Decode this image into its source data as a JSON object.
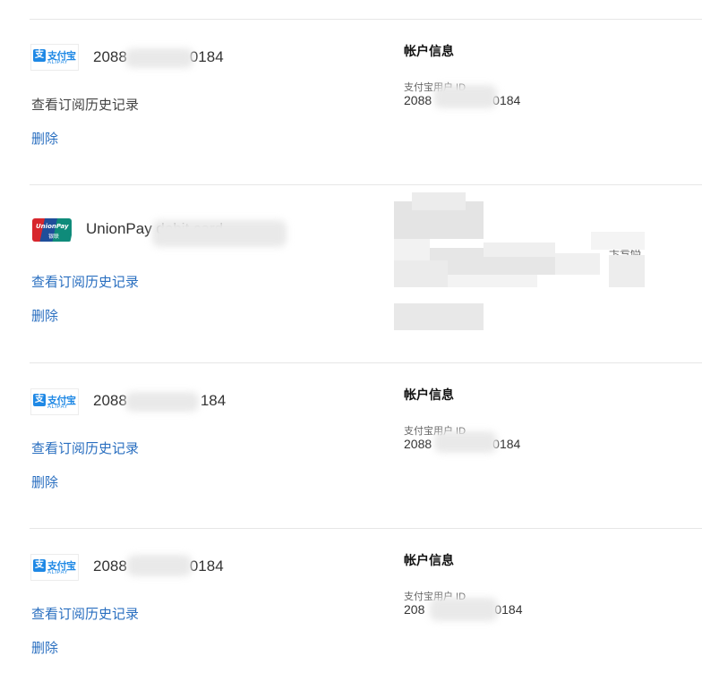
{
  "entries": [
    {
      "type": "alipay",
      "account_prefix": "2088",
      "account_suffix": "0184",
      "history_link": "查看订阅历史记录",
      "delete_link": "删除",
      "info_title": "帐户信息",
      "info_label": "支付宝用户 ID",
      "info_value_prefix": "2088",
      "info_value_suffix": "0184",
      "logo_cn": "支付宝",
      "logo_en": "ALIPAY"
    },
    {
      "type": "unionpay",
      "card_label": "UnionPay debit card",
      "history_link": "查看订阅历史记录",
      "delete_link": "删除",
      "info_fragment": "卡号码",
      "logo_text": "UnionPay",
      "logo_cn": "银联"
    },
    {
      "type": "alipay",
      "account_prefix": "2088",
      "account_suffix": "184",
      "history_link": "查看订阅历史记录",
      "delete_link": "删除",
      "info_title": "帐户信息",
      "info_label": "支付宝用户 ID",
      "info_value_prefix": "2088",
      "info_value_suffix": "0184",
      "logo_cn": "支付宝",
      "logo_en": "ALIPAY"
    },
    {
      "type": "alipay",
      "account_prefix": "2088",
      "account_suffix": "0184",
      "history_link": "查看订阅历史记录",
      "delete_link": "删除",
      "info_title": "帐户信息",
      "info_label": "支付宝用户 ID",
      "info_value_prefix": "208",
      "info_value_suffix": "0184",
      "logo_cn": "支付宝",
      "logo_en": "ALIPAY"
    }
  ],
  "colors": {
    "link": "#2a6fc0",
    "alipay_blue": "#1e88e5",
    "divider": "#e6e6e6"
  },
  "icons": [
    "alipay-logo-icon",
    "unionpay-logo-icon"
  ]
}
